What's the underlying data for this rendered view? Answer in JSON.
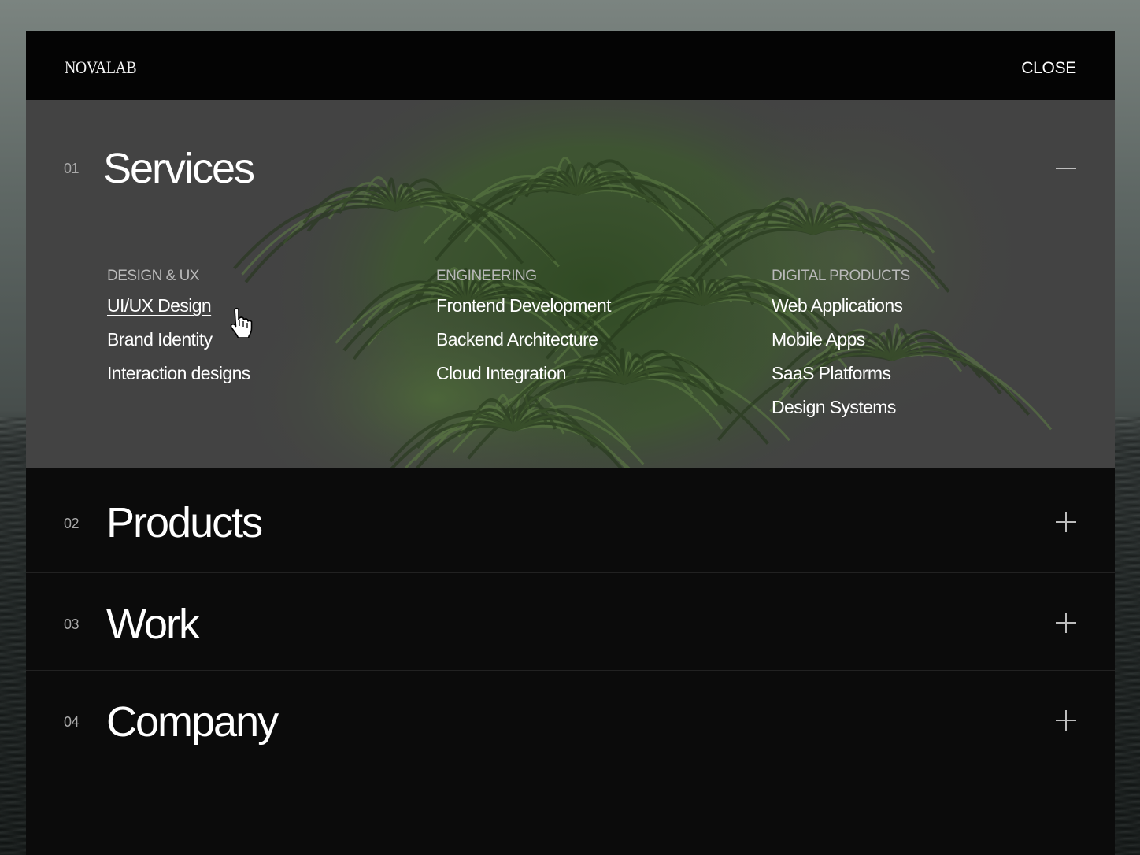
{
  "header": {
    "logo": "NOVALAB",
    "close_label": "CLOSE"
  },
  "sections": [
    {
      "number": "01",
      "title": "Services",
      "expanded": true,
      "toggle_icon": "minus-icon",
      "columns": [
        {
          "heading": "DESIGN & UX",
          "links": [
            "UI/UX Design",
            "Brand Identity",
            "Interaction designs"
          ],
          "active_index": 0
        },
        {
          "heading": "ENGINEERING",
          "links": [
            "Frontend Development",
            "Backend Architecture",
            "Cloud Integration"
          ]
        },
        {
          "heading": "DIGITAL PRODUCTS",
          "links": [
            "Web Applications",
            "Mobile Apps",
            "SaaS Platforms",
            "Design Systems"
          ]
        }
      ]
    },
    {
      "number": "02",
      "title": "Products",
      "expanded": false,
      "toggle_icon": "plus-icon"
    },
    {
      "number": "03",
      "title": "Work",
      "expanded": false,
      "toggle_icon": "plus-icon"
    },
    {
      "number": "04",
      "title": "Company",
      "expanded": false,
      "toggle_icon": "plus-icon"
    }
  ],
  "colors": {
    "panel": "#0b0b0b",
    "topbar": "#040404",
    "expanded_bg": "#434343",
    "foliage": "#3f5a30"
  }
}
